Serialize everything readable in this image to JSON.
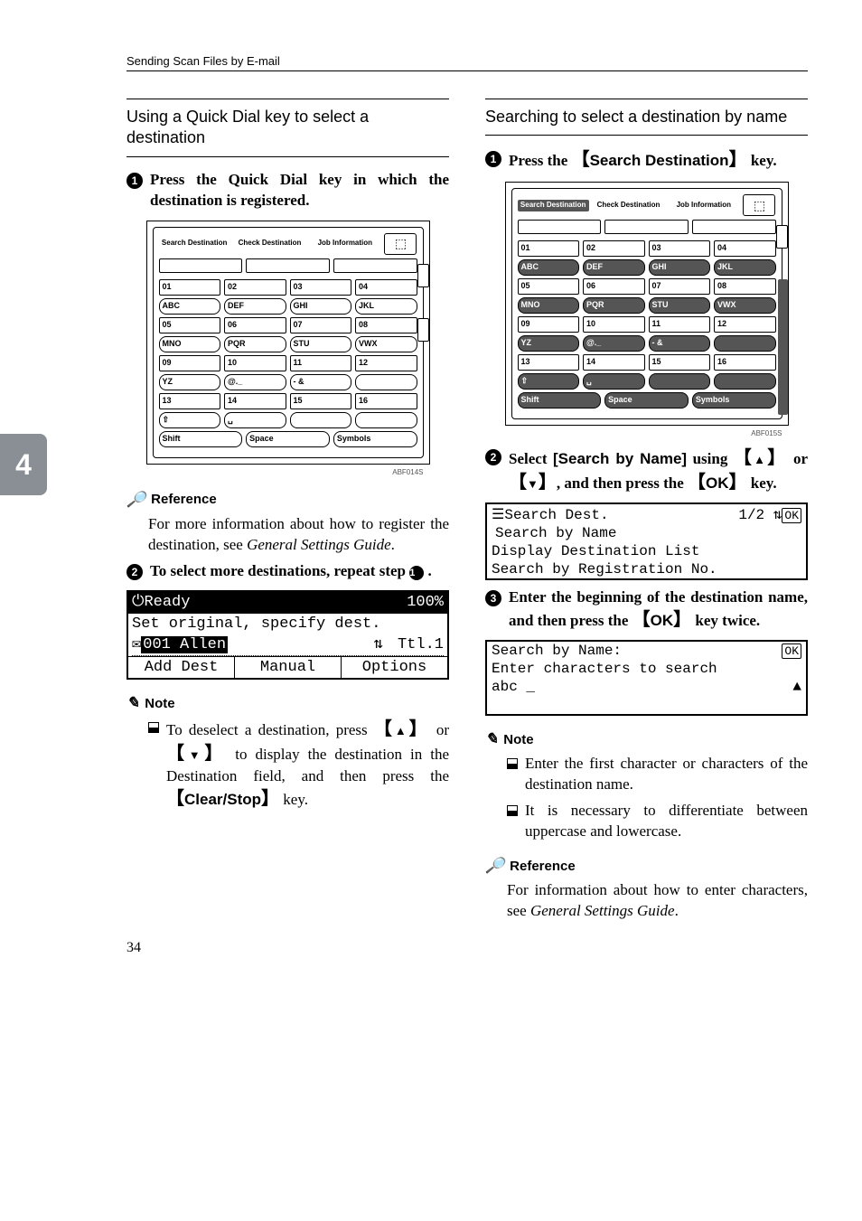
{
  "header": "Sending Scan Files by E-mail",
  "page_number": "34",
  "side_tab": "4",
  "left": {
    "heading": "Using a Quick Dial key to select a destination",
    "step1": "Press the Quick Dial key in which the destination is registered.",
    "keypad": {
      "top_labels": [
        "Search Destination",
        "Check Destination",
        "Job Information"
      ],
      "rows": [
        [
          "01",
          "02",
          "03",
          "04"
        ],
        [
          "ABC",
          "DEF",
          "GHI",
          "JKL"
        ],
        [
          "05",
          "06",
          "07",
          "08"
        ],
        [
          "MNO",
          "PQR",
          "STU",
          "VWX"
        ],
        [
          "09",
          "10",
          "11",
          "12"
        ],
        [
          "YZ",
          "@._",
          "- &",
          ""
        ],
        [
          "13",
          "14",
          "15",
          "16"
        ]
      ],
      "bottom": [
        "⇧",
        "␣",
        "",
        ""
      ],
      "bottom2": [
        "Shift",
        "Space",
        "Symbols"
      ],
      "fig_code": "ABF014S"
    },
    "reference_label": "Reference",
    "reference_text_a": "For more information about how to register the destination, see ",
    "reference_text_em": "General Settings Guide",
    "reference_text_b": ".",
    "step2_a": "To select more destinations, repeat step ",
    "step2_b": " .",
    "lcd1": {
      "title_left": "Ready",
      "title_right": "100%",
      "line2": "Set original, specify dest.",
      "line3_left": "001 Allen",
      "line3_right": "Ttl.1",
      "tabs": [
        "Add Dest",
        "Manual",
        "Options"
      ]
    },
    "note_label": "Note",
    "note1_a": "To deselect a destination, press ",
    "note1_b": " or ",
    "note1_c": " to display the destination in the Destination field, and then press the ",
    "note1_key": "Clear/Stop",
    "note1_d": " key."
  },
  "right": {
    "heading": "Searching to select a destination by name",
    "step1_a": "Press the ",
    "step1_key": "Search Destination",
    "step1_b": " key.",
    "keypad": {
      "top_labels": [
        "Search Destination",
        "Check Destination",
        "Job Information"
      ],
      "rows": [
        [
          "01",
          "02",
          "03",
          "04"
        ],
        [
          "ABC",
          "DEF",
          "GHI",
          "JKL"
        ],
        [
          "05",
          "06",
          "07",
          "08"
        ],
        [
          "MNO",
          "PQR",
          "STU",
          "VWX"
        ],
        [
          "09",
          "10",
          "11",
          "12"
        ],
        [
          "YZ",
          "@._",
          "- &",
          ""
        ],
        [
          "13",
          "14",
          "15",
          "16"
        ]
      ],
      "bottom": [
        "⇧",
        "␣",
        "",
        ""
      ],
      "bottom2": [
        "Shift",
        "Space",
        "Symbols"
      ],
      "fig_code": "ABF015S"
    },
    "step2_a": "Select ",
    "step2_soft": "[Search by Name]",
    "step2_b": " using ",
    "step2_c": " or ",
    "step2_d": ", and then press the ",
    "step2_key": "OK",
    "step2_e": " key.",
    "lcd2": {
      "title_left": "Search Dest.",
      "title_right": "1/2",
      "ok": "OK",
      "line_hi": "Search by Name",
      "line3": "Display Destination List",
      "line4": "Search by Registration No."
    },
    "step3_a": "Enter the beginning of the destination name, and then press the ",
    "step3_key": "OK",
    "step3_b": " key twice.",
    "lcd3": {
      "title": "Search by Name:",
      "ok": "OK",
      "line2": "Enter characters to search",
      "line3": "abc _"
    },
    "note_label": "Note",
    "note1": "Enter the first character or characters of the destination name.",
    "note2": "It is necessary to differentiate between uppercase and lowercase.",
    "reference_label": "Reference",
    "reference_a": "For information about how to enter characters, see ",
    "reference_em": "General Settings Guide",
    "reference_b": "."
  }
}
